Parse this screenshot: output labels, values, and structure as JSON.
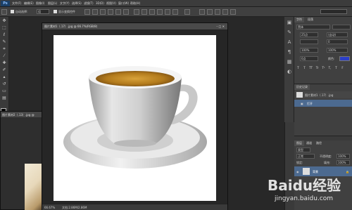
{
  "app": {
    "logo": "Ps"
  },
  "menu": {
    "items": [
      "文件(F)",
      "编辑(E)",
      "图像(I)",
      "图层(L)",
      "文字(Y)",
      "选择(S)",
      "滤镜(T)",
      "3D(D)",
      "视图(V)",
      "窗口(W)",
      "帮助(H)"
    ]
  },
  "window_controls": [
    "–",
    "□",
    "✕"
  ],
  "options_bar": {
    "auto_select_label": "自动选择:",
    "auto_select_value": "组",
    "show_transform_label": "显示变换控件"
  },
  "documents": {
    "main": {
      "title": "图片素材1（.17）.jpg @ 66.7%(RGB/8)",
      "zoom": "66.67%",
      "doc_size": "文档:2.86M/2.86M"
    },
    "second": {
      "title": "图片素材2（.13）.jpg @"
    }
  },
  "character_panel": {
    "tabs": [
      "字符",
      "段落"
    ],
    "font_family": "黑体",
    "font_size": "25点",
    "leading": "(自动)",
    "tracking": "0",
    "scale_v": "100%",
    "scale_h": "100%",
    "baseline": "0点",
    "color_label": "颜色:",
    "color_hex": "#2b3ec8",
    "format_buttons": [
      "T",
      "T",
      "TT",
      "Tr",
      "T¹",
      "T,",
      "T",
      "F"
    ]
  },
  "history_panel": {
    "tab": "历史记录",
    "document": "图片素材1（.17）.jpg",
    "states": [
      "打开"
    ]
  },
  "layers_panel": {
    "tabs": [
      "图层",
      "通道",
      "路径"
    ],
    "filter_label": "类型",
    "blend_mode": "正常",
    "opacity_label": "不透明度:",
    "opacity": "100%",
    "lock_label": "锁定:",
    "fill_label": "填充:",
    "fill": "100%",
    "layers": [
      {
        "name": "背景"
      }
    ]
  },
  "watermark": {
    "brand": "Baidu经验",
    "url": "jingyan.baidu.com"
  }
}
